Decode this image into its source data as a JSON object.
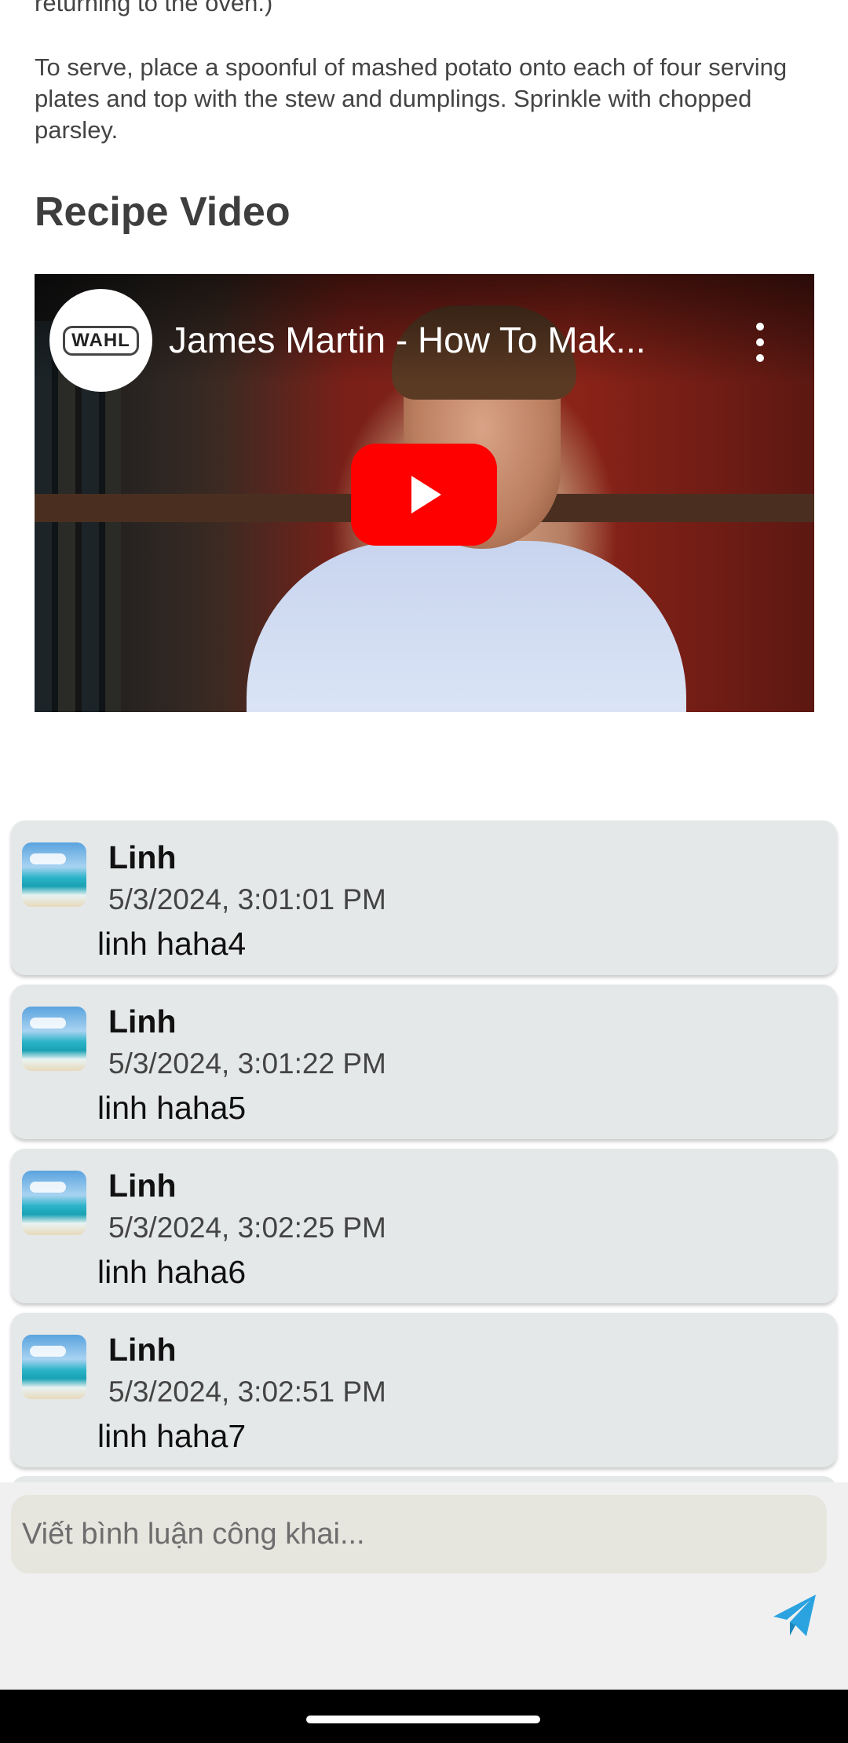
{
  "article": {
    "previous_line": "returning to the oven.)",
    "serve_paragraph": "To serve, place a spoonful of mashed potato onto each of four serving plates and top with the stew and dumplings. Sprinkle with chopped parsley.",
    "section_title": "Recipe Video"
  },
  "video": {
    "channel_logo_text": "WAHL",
    "title": "James Martin - How To Mak...",
    "icons": {
      "menu": "more-vert-icon",
      "play": "youtube-play-icon"
    },
    "play_color": "#ff0000"
  },
  "comments": [
    {
      "name": "Linh",
      "time": "5/3/2024, 3:01:01 PM",
      "text": "linh haha4"
    },
    {
      "name": "Linh",
      "time": "5/3/2024, 3:01:22 PM",
      "text": "linh haha5"
    },
    {
      "name": "Linh",
      "time": "5/3/2024, 3:02:25 PM",
      "text": "linh haha6"
    },
    {
      "name": "Linh",
      "time": "5/3/2024, 3:02:51 PM",
      "text": "linh haha7"
    }
  ],
  "composer": {
    "placeholder": "Viết bình luận công khai...",
    "value": "",
    "send_icon": "send-icon",
    "send_color": "#2ba3e0"
  }
}
